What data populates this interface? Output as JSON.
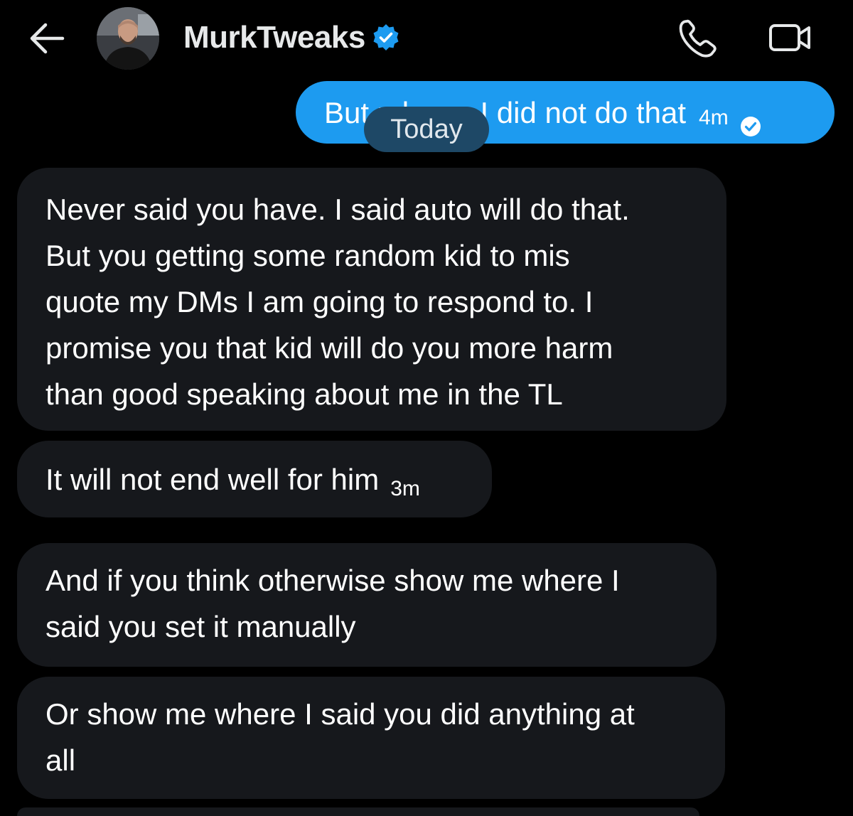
{
  "header": {
    "name": "MurkTweaks",
    "back_icon": "arrow-left-icon",
    "verified_icon": "verified-badge-icon",
    "call_icon": "phone-icon",
    "video_icon": "video-camera-icon",
    "accent_color": "#1d9bf0"
  },
  "divider": {
    "label": "Today"
  },
  "messages": [
    {
      "direction": "sent",
      "text": "But u know I did not do that",
      "time": "4m",
      "status_icon": "seen-check-icon"
    },
    {
      "direction": "received",
      "text": "Never said you have.  I said auto will do that.\nBut you getting some random kid to mis\nquote my DMs I am going to respond to. I\npromise you that kid will do you more harm\nthan good speaking about me in the TL"
    },
    {
      "direction": "received",
      "text": "It will not end well for him",
      "time": "3m"
    },
    {
      "direction": "received",
      "text": "And if you think otherwise show me where I\nsaid you set it manually"
    },
    {
      "direction": "received",
      "text": "Or show me where I said you did anything at\nall"
    }
  ],
  "colors": {
    "background": "#000000",
    "received_bubble": "#16181c",
    "sent_bubble": "#1d9bf0",
    "divider_pill": "#1e4866"
  }
}
